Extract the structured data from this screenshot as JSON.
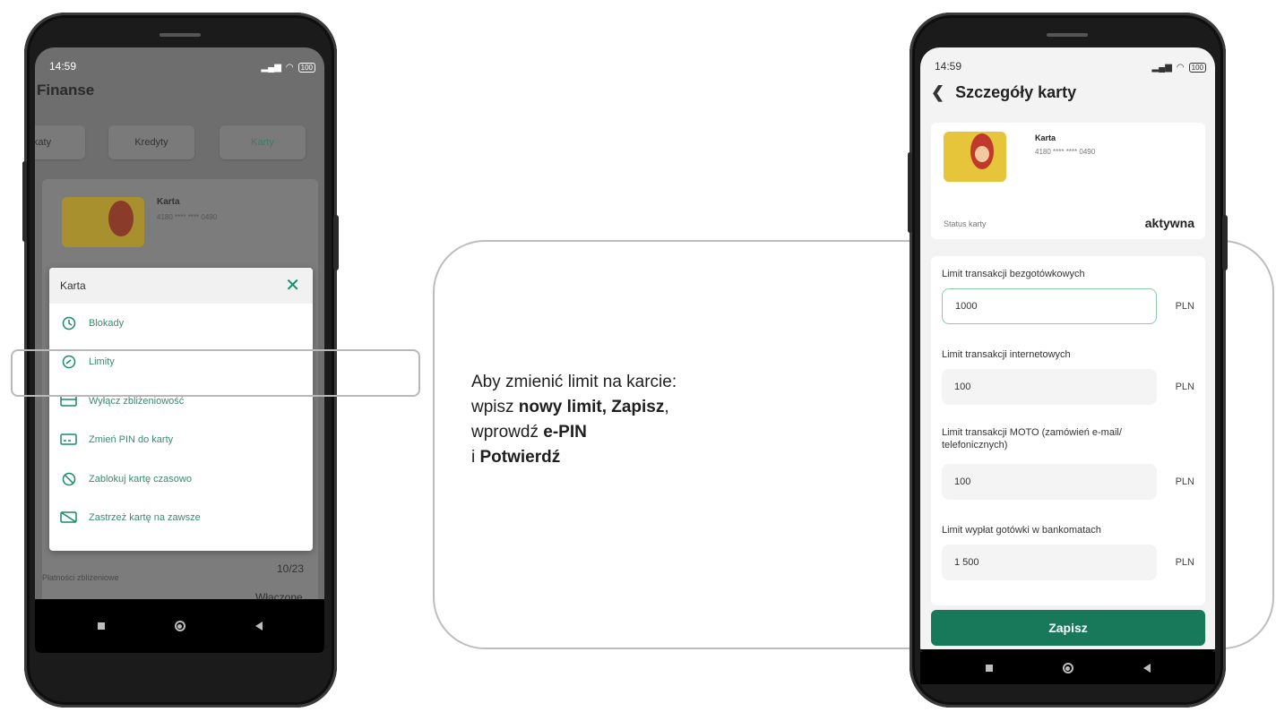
{
  "colors": {
    "accent": "#17795a",
    "accent_light": "#3c8a6c",
    "card_yellow": "#e7c53a"
  },
  "left_phone": {
    "status_time": "14:59",
    "battery": "100",
    "title": "Finanse",
    "tabs": [
      "katy",
      "Kredyty",
      "Karty"
    ],
    "card": {
      "name": "Karta",
      "number": "4180 **** **** 0490"
    },
    "sheet": {
      "title": "Karta",
      "items": [
        {
          "label": "Blokady",
          "icon": "history-icon"
        },
        {
          "label": "Limity",
          "icon": "gauge-icon"
        },
        {
          "label": "Wyłącz zbliżeniowość",
          "icon": "card-contactless-icon"
        },
        {
          "label": "Zmień PIN do karty",
          "icon": "pin-card-icon"
        },
        {
          "label": "Zablokuj kartę czasowo",
          "icon": "block-icon"
        },
        {
          "label": "Zastrzeż kartę na zawsze",
          "icon": "card-cancel-icon"
        }
      ]
    },
    "behind_value": "10/23",
    "contactless_label": "Płatności zbliżeniowe",
    "contactless_value": "Włączone"
  },
  "instruction": {
    "line1": "Aby zmienić limit na karcie:",
    "line2_pre": "wpisz ",
    "line2_bold": "nowy limit, Zapisz",
    "line2_post": ",",
    "line3_pre": "wprowdź ",
    "line3_bold": "e-PIN",
    "line4_pre": "i ",
    "line4_bold": "Potwierdź"
  },
  "right_phone": {
    "status_time": "14:59",
    "battery": "100",
    "header_title": "Szczegóły karty",
    "card": {
      "name": "Karta",
      "number": "4180 **** **** 0490"
    },
    "status_label": "Status karty",
    "status_value": "aktywna",
    "limits": [
      {
        "label": "Limit transakcji bezgotówkowych",
        "value": "1000",
        "currency": "PLN"
      },
      {
        "label": "Limit transakcji internetowych",
        "value": "100",
        "currency": "PLN"
      },
      {
        "label": "Limit transakcji MOTO (zamówień e-mail/ telefonicznych)",
        "value": "100",
        "currency": "PLN"
      },
      {
        "label": "Limit wypłat gotówki w bankomatach",
        "value": "1 500",
        "currency": "PLN"
      }
    ],
    "save_label": "Zapisz"
  }
}
